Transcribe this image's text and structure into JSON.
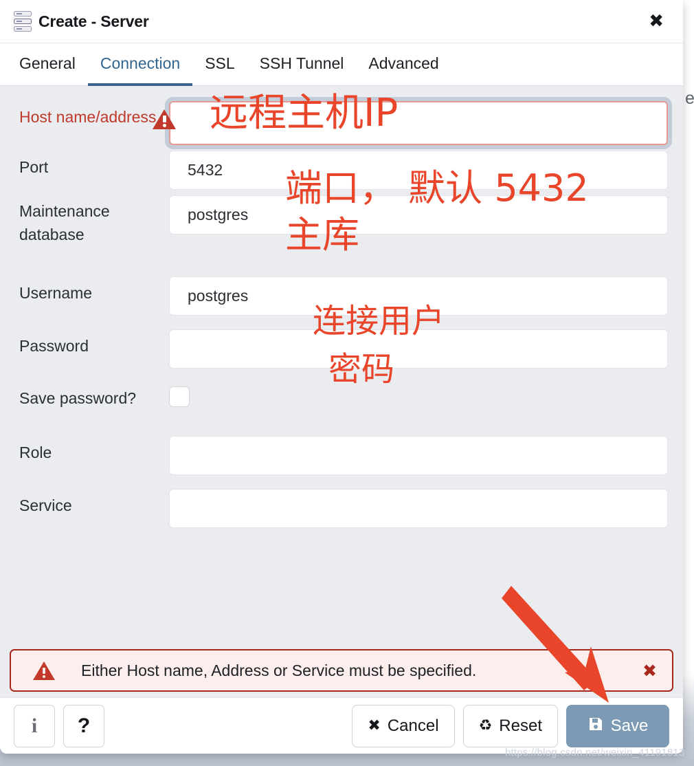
{
  "dialog": {
    "title": "Create - Server",
    "icon": "server-stack-icon",
    "close_label": "✖"
  },
  "tabs": [
    {
      "label": "General",
      "active": false
    },
    {
      "label": "Connection",
      "active": true
    },
    {
      "label": "SSL",
      "active": false
    },
    {
      "label": "SSH Tunnel",
      "active": false
    },
    {
      "label": "Advanced",
      "active": false
    }
  ],
  "form": {
    "fields": [
      {
        "label": "Host name/address",
        "value": "",
        "type": "text",
        "error": true
      },
      {
        "label": "Port",
        "value": "5432",
        "type": "text",
        "error": false
      },
      {
        "label": "Maintenance database",
        "value": "postgres",
        "type": "text",
        "error": false
      },
      {
        "label": "Username",
        "value": "postgres",
        "type": "text",
        "error": false
      },
      {
        "label": "Password",
        "value": "",
        "type": "password",
        "error": false
      },
      {
        "label": "Save password?",
        "value": "",
        "type": "checkbox",
        "error": false
      },
      {
        "label": "Role",
        "value": "",
        "type": "text",
        "error": false
      },
      {
        "label": "Service",
        "value": "",
        "type": "text",
        "error": false
      }
    ]
  },
  "annotations": {
    "host": "远程主机IP",
    "port": "端口， 默认 5432",
    "database": "主库",
    "username": "连接用户",
    "password": "密码",
    "color": "#e8452a"
  },
  "alert": {
    "message": "Either Host name, Address or Service must be specified.",
    "close_label": "✖",
    "icon": "warning-triangle-icon",
    "border_color": "#a8281c",
    "bg_color": "#fbeeec"
  },
  "footer": {
    "info_label": "i",
    "help_label": "?",
    "cancel_label": "Cancel",
    "cancel_icon": "✖",
    "reset_label": "Reset",
    "reset_icon": "♻",
    "save_label": "Save",
    "save_icon": "💾",
    "save_color": "#7d9ab5"
  },
  "background": {
    "ghost_char": "e"
  },
  "watermark": "https://blog.csdn.net/weixin_41191813"
}
